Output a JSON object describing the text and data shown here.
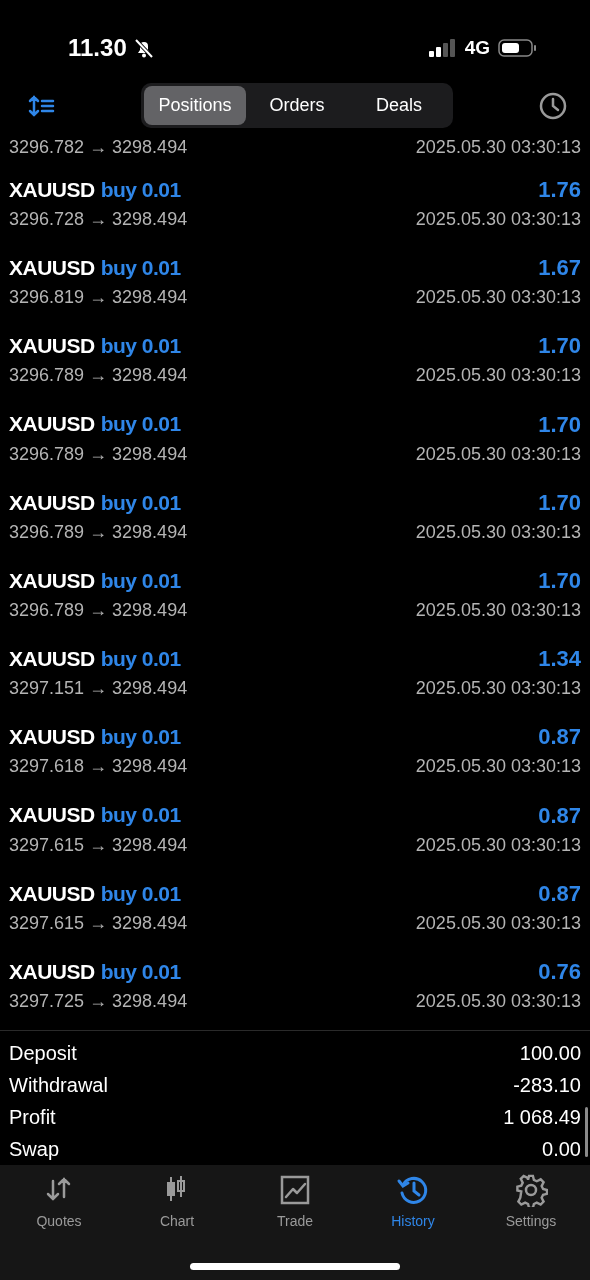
{
  "status_bar": {
    "time": "11.30",
    "silent": true,
    "network": "4G"
  },
  "segments": [
    {
      "label": "Positions",
      "selected": true
    },
    {
      "label": "Orders",
      "selected": false
    },
    {
      "label": "Deals",
      "selected": false
    }
  ],
  "trades": [
    {
      "prices": "3296.782 → 3298.494",
      "time": "2025.05.30 03:30:13"
    },
    {
      "symbol": "XAUUSD",
      "side": "buy 0.01",
      "profit": "1.76",
      "prices": "3296.728 → 3298.494",
      "time": "2025.05.30 03:30:13"
    },
    {
      "symbol": "XAUUSD",
      "side": "buy 0.01",
      "profit": "1.67",
      "prices": "3296.819 → 3298.494",
      "time": "2025.05.30 03:30:13"
    },
    {
      "symbol": "XAUUSD",
      "side": "buy 0.01",
      "profit": "1.70",
      "prices": "3296.789 → 3298.494",
      "time": "2025.05.30 03:30:13"
    },
    {
      "symbol": "XAUUSD",
      "side": "buy 0.01",
      "profit": "1.70",
      "prices": "3296.789 → 3298.494",
      "time": "2025.05.30 03:30:13"
    },
    {
      "symbol": "XAUUSD",
      "side": "buy 0.01",
      "profit": "1.70",
      "prices": "3296.789 → 3298.494",
      "time": "2025.05.30 03:30:13"
    },
    {
      "symbol": "XAUUSD",
      "side": "buy 0.01",
      "profit": "1.70",
      "prices": "3296.789 → 3298.494",
      "time": "2025.05.30 03:30:13"
    },
    {
      "symbol": "XAUUSD",
      "side": "buy 0.01",
      "profit": "1.34",
      "prices": "3297.151 → 3298.494",
      "time": "2025.05.30 03:30:13"
    },
    {
      "symbol": "XAUUSD",
      "side": "buy 0.01",
      "profit": "0.87",
      "prices": "3297.618 → 3298.494",
      "time": "2025.05.30 03:30:13"
    },
    {
      "symbol": "XAUUSD",
      "side": "buy 0.01",
      "profit": "0.87",
      "prices": "3297.615 → 3298.494",
      "time": "2025.05.30 03:30:13"
    },
    {
      "symbol": "XAUUSD",
      "side": "buy 0.01",
      "profit": "0.87",
      "prices": "3297.615 → 3298.494",
      "time": "2025.05.30 03:30:13"
    },
    {
      "symbol": "XAUUSD",
      "side": "buy 0.01",
      "profit": "0.76",
      "prices": "3297.725 → 3298.494",
      "time": "2025.05.30 03:30:13"
    }
  ],
  "summary": [
    {
      "label": "Deposit",
      "value": "100.00"
    },
    {
      "label": "Withdrawal",
      "value": "-283.10"
    },
    {
      "label": "Profit",
      "value": "1 068.49"
    },
    {
      "label": "Swap",
      "value": "0.00"
    }
  ],
  "tab_bar": [
    {
      "label": "Quotes",
      "kind": "quotes",
      "selected": false
    },
    {
      "label": "Chart",
      "kind": "chart",
      "selected": false
    },
    {
      "label": "Trade",
      "kind": "trade",
      "selected": false
    },
    {
      "label": "History",
      "kind": "history",
      "selected": true
    },
    {
      "label": "Settings",
      "kind": "settings",
      "selected": false
    }
  ]
}
